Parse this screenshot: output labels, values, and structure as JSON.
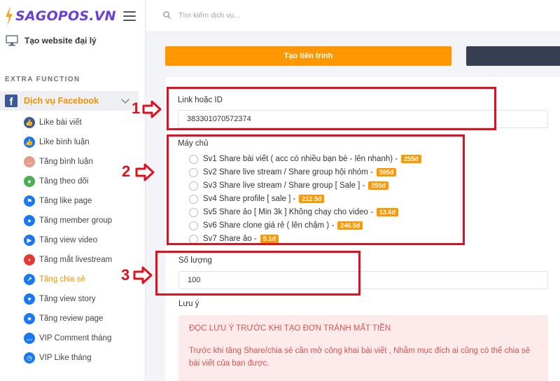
{
  "logo": {
    "text": "SAGOPOS.VN"
  },
  "sidebar": {
    "agent_label": "Tạo website đại lý",
    "section_title": "EXTRA FUNCTION",
    "group_label": "Dịch vụ Facebook",
    "items": [
      {
        "label": "Like bài viết",
        "icon": "thumbs-up-icon",
        "color": "#3b5998"
      },
      {
        "label": "Like bình luận",
        "icon": "like-comment-icon",
        "color": "#1877f2"
      },
      {
        "label": "Tăng bình luận",
        "icon": "comment-icon",
        "color": "#e89a8a"
      },
      {
        "label": "Tăng theo dõi",
        "icon": "follower-icon",
        "color": "#4caf50"
      },
      {
        "label": "Tăng like page",
        "icon": "flag-icon",
        "color": "#1877f2"
      },
      {
        "label": "Tăng member group",
        "icon": "group-icon",
        "color": "#1877f2"
      },
      {
        "label": "Tăng view video",
        "icon": "play-icon",
        "color": "#1877f2"
      },
      {
        "label": "Tăng mắt livestream",
        "icon": "live-icon",
        "color": "#e53935"
      },
      {
        "label": "Tăng chia sẻ",
        "icon": "share-icon",
        "color": "#1877f2",
        "active": true
      },
      {
        "label": "Tăng view story",
        "icon": "heart-icon",
        "color": "#1877f2"
      },
      {
        "label": "Tăng review page",
        "icon": "review-icon",
        "color": "#1877f2"
      },
      {
        "label": "VIP Comment tháng",
        "icon": "chat-icon",
        "color": "#1877f2"
      },
      {
        "label": "VIP Like tháng",
        "icon": "clock-icon",
        "color": "#1877f2"
      }
    ]
  },
  "search": {
    "placeholder": "Tìm kiếm dịch vụ..."
  },
  "actions": {
    "create_label": "Tạo tiến trình"
  },
  "form": {
    "link_label": "Link hoặc ID",
    "link_value": "383301070572374",
    "server_label": "Máy chủ",
    "servers": [
      {
        "label": "Sv1 Share bài viết ( acc có nhiều bạn bè - lên nhanh) -",
        "price": "255đ"
      },
      {
        "label": "Sv2 Share live stream / Share group hội nhóm -",
        "price": "595đ"
      },
      {
        "label": "Sv3 Share live stream / Share group [ Sale ] -",
        "price": "255đ"
      },
      {
        "label": "Sv4 Share profile [ sale ] -",
        "price": "212.5đ"
      },
      {
        "label": "Sv5 Share ảo [ Min 3k ] Không chạy cho video -",
        "price": "13.6đ"
      },
      {
        "label": "Sv6 Share clone giá rẻ ( lên chậm ) -",
        "price": "246.5đ"
      },
      {
        "label": "Sv7 Share ảo -",
        "price": "5.1đ"
      }
    ],
    "quantity_label": "Số lượng",
    "quantity_value": "100",
    "note_label": "Lưu ý",
    "note_title": "ĐỌC LƯU Ý TRƯỚC KHI TẠO ĐƠN TRÁNH MẤT TIỀN",
    "note_text": "Trước khi tăng Share/chia sẻ cần mở công khai bài viết , Nhằm mục đích ai cũng có thể chia sẻ bài viết của bạn được."
  },
  "annotations": [
    "1",
    "2",
    "3"
  ],
  "colors": {
    "accent": "#ff9800",
    "brand": "#6c3fd4",
    "annotation": "#e0101e",
    "dark_button": "#363f52"
  }
}
